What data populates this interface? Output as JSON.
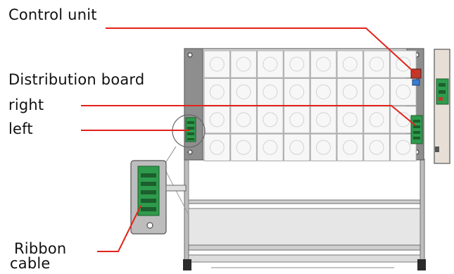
{
  "labels": {
    "control_unit": "Control unit",
    "distribution_board": "Distribution board",
    "right": "right",
    "left": "left",
    "ribbon": "Ribbon",
    "cable": "cable"
  },
  "colors": {
    "leader_line": "#e2231a",
    "frame_gray": "#8c8c8c",
    "frame_dark": "#555555",
    "tile_fill": "#f7f7f7",
    "tile_stroke": "#a8a8a8",
    "board_green": "#2e9b4c",
    "board_dark": "#1d5e2e",
    "enclosure_fill": "#e7dfd6"
  },
  "grid": {
    "rows": 4,
    "columns": 8
  },
  "icons": [
    "control-unit-module",
    "distribution-board-right",
    "distribution-board-left",
    "ribbon-cable-connector"
  ]
}
